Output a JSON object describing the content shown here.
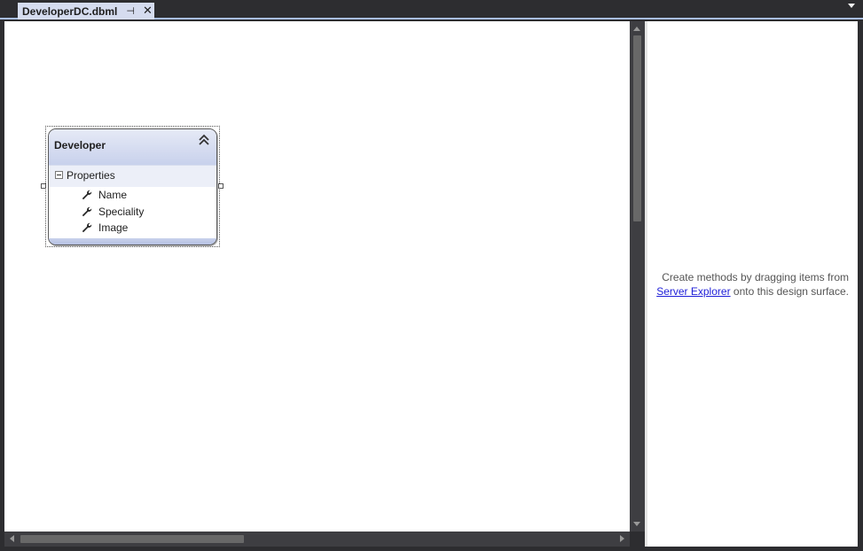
{
  "tab": {
    "title": "DeveloperDC.dbml",
    "pin_glyph": "⊣",
    "close_glyph": "✕"
  },
  "entity": {
    "title": "Developer",
    "section_label": "Properties",
    "properties": [
      "Name",
      "Speciality",
      "Image"
    ]
  },
  "methods_pane": {
    "hint_before": "Create methods by dragging items from",
    "link_text": "Server Explorer",
    "hint_after": " onto this design surface."
  },
  "icons": {
    "pin": "pin-icon",
    "close": "close-icon",
    "collapse": "double-chevron-up-icon",
    "property": "wrench-icon",
    "section_toggle": "minus-box-icon"
  },
  "colors": {
    "chrome": "#2d2d30",
    "tab_active": "#d5dcef",
    "entity_header": "#c8d1ec",
    "link": "#1e1ed8"
  }
}
